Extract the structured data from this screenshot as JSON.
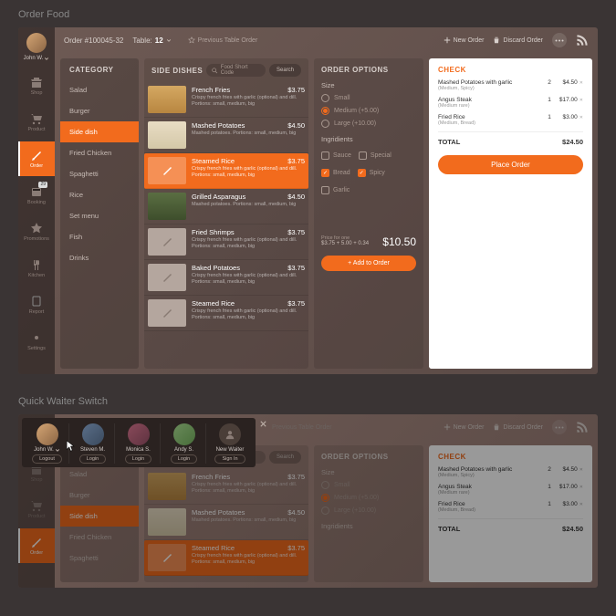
{
  "sections": {
    "order_food": "Order Food",
    "quick_switch": "Quick Waiter Switch"
  },
  "user": {
    "name": "John W."
  },
  "rail": [
    {
      "icon": "shop",
      "label": "Shop"
    },
    {
      "icon": "product",
      "label": "Product"
    },
    {
      "icon": "order",
      "label": "Order",
      "active": true
    },
    {
      "icon": "booking",
      "label": "Booking",
      "badge": "29"
    },
    {
      "icon": "promotions",
      "label": "Promotions"
    },
    {
      "icon": "kitchen",
      "label": "Kitchen"
    },
    {
      "icon": "report",
      "label": "Report"
    },
    {
      "icon": "settings",
      "label": "Settings"
    }
  ],
  "topbar": {
    "order_id": "Order #100045-32",
    "table_label": "Table:",
    "table_num": "12",
    "prev_order": "Previous Table Order",
    "new_order": "New Order",
    "discard": "Discard Order"
  },
  "categories": {
    "title": "CATEGORY",
    "items": [
      "Salad",
      "Burger",
      "Side dish",
      "Fried Chicken",
      "Spaghetti",
      "Rice",
      "Set menu",
      "Fish",
      "Drinks"
    ],
    "active": 2
  },
  "dishes": {
    "title": "SIDE DISHES",
    "search_placeholder": "Food Short Code",
    "search_btn": "Search",
    "items": [
      {
        "name": "French Fries",
        "price": "$3.75",
        "desc": "Crispy french fries with garlic (optional) and dill. Portions: small, medium, big",
        "thumb": "fries"
      },
      {
        "name": "Mashed Potatoes",
        "price": "$4.50",
        "desc": "Mashed potatoes. Portions: small, medium, big",
        "thumb": "mash"
      },
      {
        "name": "Steamed Rice",
        "price": "$3.75",
        "desc": "Crispy french fries with garlic (optional) and dill. Portions: small, medium, big",
        "thumb": "ph",
        "active": true
      },
      {
        "name": "Grilled Asparagus",
        "price": "$4.50",
        "desc": "Mashed potatoes. Portions: small, medium, big",
        "thumb": "asp"
      },
      {
        "name": "Fried Shrimps",
        "price": "$3.75",
        "desc": "Crispy french fries with garlic (optional) and dill. Portions: small, medium, big",
        "thumb": "ph"
      },
      {
        "name": "Baked Potatoes",
        "price": "$3.75",
        "desc": "Crispy french fries with garlic (optional) and dill. Portions: small, medium, big",
        "thumb": "ph"
      },
      {
        "name": "Steamed Rice",
        "price": "$3.75",
        "desc": "Crispy french fries with garlic (optional) and dill. Portions: small, medium, big",
        "thumb": "ph"
      }
    ]
  },
  "options": {
    "title": "ORDER OPTIONS",
    "size_label": "Size",
    "sizes": [
      {
        "label": "Small",
        "checked": false
      },
      {
        "label": "Medium (+5.00)",
        "checked": true
      },
      {
        "label": "Large (+10.00)",
        "checked": false
      }
    ],
    "ing_label": "Ingridients",
    "ings": [
      {
        "label": "Sauce",
        "checked": false
      },
      {
        "label": "Special",
        "checked": false
      },
      {
        "label": "Bread",
        "checked": true
      },
      {
        "label": "Spicy",
        "checked": true
      },
      {
        "label": "Garlic",
        "checked": false
      }
    ],
    "price_note": "Price for one",
    "price_calc": "$3.75 + 5.00 + 0.34",
    "price_total": "$10.50",
    "add_btn": "+ Add to Order"
  },
  "check": {
    "title": "CHECK",
    "lines": [
      {
        "name": "Mashed Potatoes with garlic",
        "sub": "(Medium, Spicy)",
        "qty": "2",
        "amt": "$4.50"
      },
      {
        "name": "Angus Steak",
        "sub": "(Medium rare)",
        "qty": "1",
        "amt": "$17.00"
      },
      {
        "name": "Fried Rice",
        "sub": "(Medium, Bread)",
        "qty": "1",
        "amt": "$3.00"
      }
    ],
    "total_label": "TOTAL",
    "total": "$24.50",
    "place_btn": "Place Order"
  },
  "waiters": {
    "list": [
      {
        "name": "John W.",
        "btn": "Logout",
        "cls": "a1",
        "chev": true
      },
      {
        "name": "Steven M.",
        "btn": "Login",
        "cls": "a2"
      },
      {
        "name": "Monica S.",
        "btn": "Login",
        "cls": "a3"
      },
      {
        "name": "Andy S.",
        "btn": "Login",
        "cls": "a4"
      },
      {
        "name": "New Waiter",
        "btn": "Sign In",
        "cls": "new"
      }
    ]
  }
}
